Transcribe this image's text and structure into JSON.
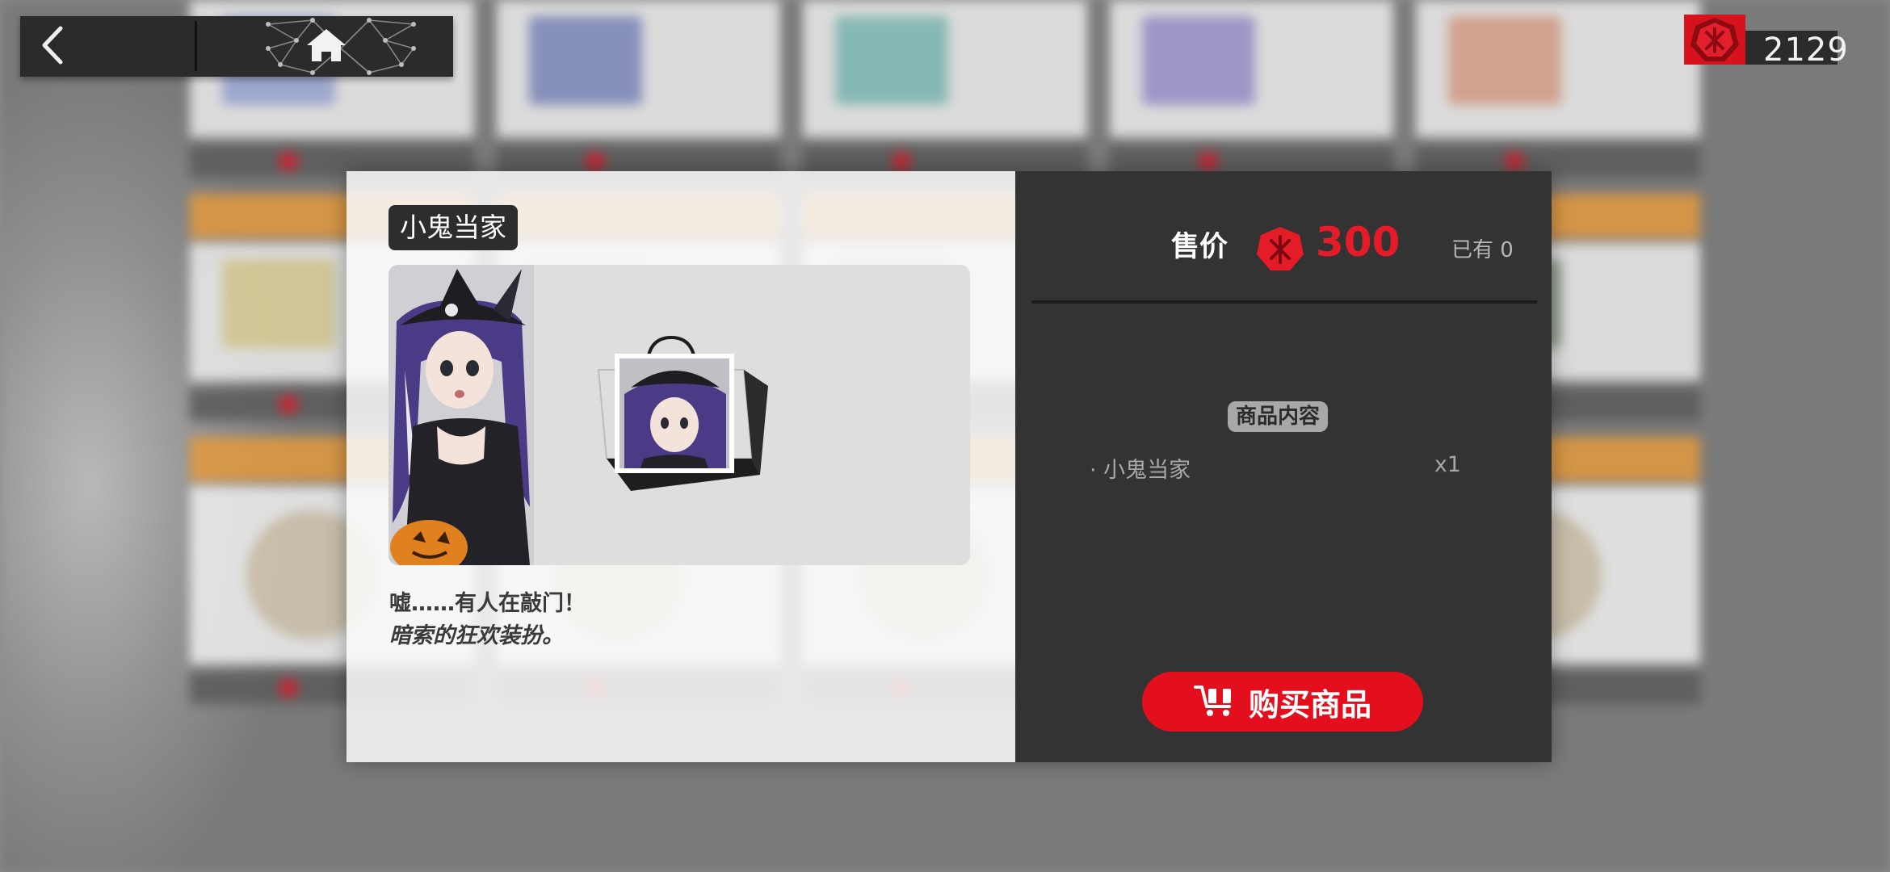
{
  "nav": {
    "back_icon": "chevron-left-icon",
    "home_icon": "home-icon"
  },
  "currency": {
    "icon": "red-gem-icon",
    "amount": "2129",
    "color": "#d6131d"
  },
  "item": {
    "title": "小鬼当家",
    "description_line1": "嘘……有人在敲门！",
    "description_line2": "暗索的狂欢装扮。"
  },
  "purchase": {
    "price_label": "售价",
    "price_value": "300",
    "price_color": "#e51c27",
    "owned": "已有 0",
    "contents_label": "商品内容",
    "contents": [
      {
        "name": "· 小鬼当家",
        "qty": "x1"
      }
    ],
    "buy_label": "购买商品",
    "buy_icon": "shopping-cart-icon",
    "buy_color": "#e30f1d"
  }
}
